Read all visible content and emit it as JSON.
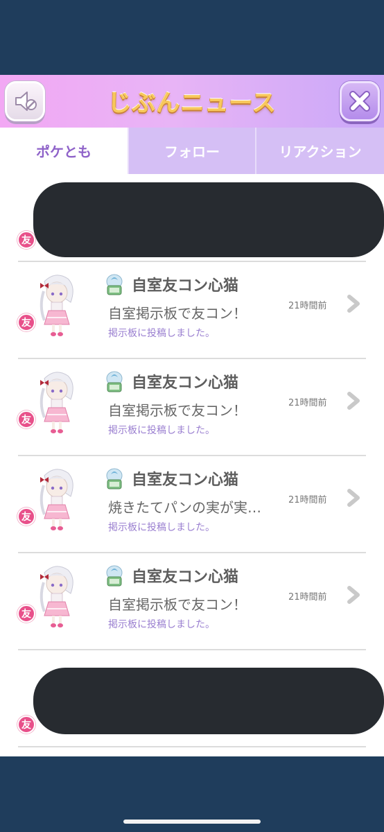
{
  "header": {
    "title": "じぶんニュース",
    "left_icon": "speaker-mute-icon",
    "right_icon": "close-icon"
  },
  "tabs": [
    {
      "label": "ポケとも",
      "active": true
    },
    {
      "label": "フォロー",
      "active": false
    },
    {
      "label": "リアクション",
      "active": false
    }
  ],
  "friend_badge": "友",
  "news": [
    {
      "name": "自室友コン心猫",
      "message": "自室掲示板で友コン！",
      "subtext": "掲示板に投稿しました。",
      "time": "21時間前"
    },
    {
      "name": "自室友コン心猫",
      "message": "自室掲示板で友コン！",
      "subtext": "掲示板に投稿しました。",
      "time": "21時間前"
    },
    {
      "name": "自室友コン心猫",
      "message": "焼きたてパンの実が実…",
      "subtext": "掲示板に投稿しました。",
      "time": "21時間前"
    },
    {
      "name": "自室友コン心猫",
      "message": "自室掲示板で友コン！",
      "subtext": "掲示板に投稿しました。",
      "time": "21時間前"
    }
  ],
  "colors": {
    "background": "#1f3d5c",
    "tab_active_text": "#8f63c9",
    "tab_inactive_bg": "#d5bff5",
    "friend_badge": "#e8508a",
    "redaction": "#272b30"
  }
}
